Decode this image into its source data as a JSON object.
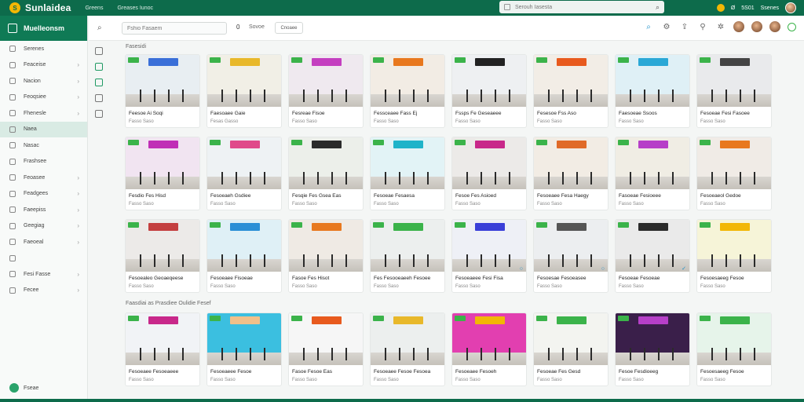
{
  "topbar": {
    "logo_glyph": "S",
    "brand": "Sunlaidea",
    "links": [
      "Greens",
      "Greases Iunoc"
    ],
    "search_placeholder": "Serouh Iasesta",
    "right_items": [
      "Ø",
      "5S01",
      "Ssenes"
    ]
  },
  "sidebar": {
    "header": "Muelleonsm",
    "items": [
      {
        "label": "Serenes",
        "chev": ""
      },
      {
        "label": "Feaceise",
        "chev": "›"
      },
      {
        "label": "Nacion",
        "chev": "›"
      },
      {
        "label": "Feoqsiee",
        "chev": "›"
      },
      {
        "label": "Fhenesle",
        "chev": "›"
      },
      {
        "label": "Naea",
        "chev": "",
        "active": true
      },
      {
        "label": "Nasac",
        "chev": ""
      },
      {
        "label": "Frashsee",
        "chev": ""
      },
      {
        "label": "Feoasee",
        "chev": "›"
      },
      {
        "label": "Feadgees",
        "chev": "›"
      },
      {
        "label": "Faeepiss",
        "chev": "›"
      },
      {
        "label": "Geegiag",
        "chev": "›"
      },
      {
        "label": "Faeoeal",
        "chev": "›"
      },
      {
        "label": "",
        "chev": ""
      },
      {
        "label": "Fesi Fasse",
        "chev": "›"
      },
      {
        "label": "Fecee",
        "chev": "›"
      }
    ],
    "footer": "Fseae"
  },
  "toolbar": {
    "search_placeholder": "Fshio Fasaem",
    "count": "0",
    "label": "Sovoe",
    "button": "Cnoaee"
  },
  "sections": [
    {
      "title": "Fasesidi"
    },
    {
      "title": "Faasdiai as Prasdiee Oulidie Fesef"
    }
  ],
  "colors": {
    "primary": "#0d6b4b",
    "sidebar_header": "#0f7a55",
    "accent_blue": "#1a8fc9",
    "tag_green": "#3bb34a"
  },
  "cards_row1": [
    {
      "t1": "Feesoe Ai Soqi",
      "t2": "Fasso Saso",
      "bg": "#e8eef2",
      "sign": "#3a6fd8"
    },
    {
      "t1": "Faesoaee Gaie",
      "t2": "Fesas Gasso",
      "bg": "#f1efe6",
      "sign": "#e8b82a"
    },
    {
      "t1": "Fesreae Fisoe",
      "t2": "Fasso Saso",
      "bg": "#efe9ef",
      "sign": "#c43fc0"
    },
    {
      "t1": "Fessceaee Fass Ej",
      "t2": "Fasso Saso",
      "bg": "#f2ece4",
      "sign": "#e8781e"
    },
    {
      "t1": "Fssps Fe Geseaeee",
      "t2": "Fasso Saso",
      "bg": "#eef0f2",
      "sign": "#222222"
    },
    {
      "t1": "Fesesoe Fss Aso",
      "t2": "Fasso Saso",
      "bg": "#f2ede6",
      "sign": "#e85a1e"
    },
    {
      "t1": "Faesoeae Ssoos",
      "t2": "Fasso Saso",
      "bg": "#dff0f6",
      "sign": "#2aa8d6"
    },
    {
      "t1": "Fesoeae Fesi Fasoee",
      "t2": "Fasso Saso",
      "bg": "#e9eaec",
      "sign": "#444444"
    }
  ],
  "cards_row2": [
    {
      "t1": "Fesdio Fes Hisd",
      "t2": "Fasso Saso",
      "bg": "#f1e4f1",
      "sign": "#c02fb6"
    },
    {
      "t1": "Fesoeaeh Gsdiee",
      "t2": "Fasso Saso",
      "bg": "#eef2f4",
      "sign": "#e04a8a"
    },
    {
      "t1": "Fesqie Fes Gsea Eas",
      "t2": "Fasso Saso",
      "bg": "#ecefea",
      "sign": "#2b2b2b"
    },
    {
      "t1": "Fesoeae Fesaesa",
      "t2": "Fasso Saso",
      "bg": "#e2f3f6",
      "sign": "#1fb3c9"
    },
    {
      "t1": "Fesoe Fes Asioed",
      "t2": "Fasso Saso",
      "bg": "#eceae8",
      "sign": "#c8288a"
    },
    {
      "t1": "Fesoeaee Fesa Haegy",
      "t2": "Fasso Saso",
      "bg": "#f2ece4",
      "sign": "#e06a28"
    },
    {
      "t1": "Fasoeae Fesioeee",
      "t2": "Fasso Saso",
      "bg": "#f0ede4",
      "sign": "#b63fc8"
    },
    {
      "t1": "Fesoeaeol Gedoe",
      "t2": "Fasso Saso",
      "bg": "#f0ebe6",
      "sign": "#e8781e"
    }
  ],
  "cards_row3": [
    {
      "t1": "Fesoealeo Geoaeqeese",
      "t2": "Fasso Saso",
      "bg": "#eceae8",
      "sign": "#c43f3f"
    },
    {
      "t1": "Fesoeaee Fisoeae",
      "t2": "Fasso Saso",
      "bg": "#dff0f6",
      "sign": "#2a8fd6"
    },
    {
      "t1": "Fasoe Fes Hisot",
      "t2": "Fasso Saso",
      "bg": "#efeae4",
      "sign": "#e8781e"
    },
    {
      "t1": "Fes Fesooeaeeh Fesoee",
      "t2": "Fasso Saso",
      "bg": "#ecefee",
      "sign": "#3bb34a"
    },
    {
      "t1": "Fesoeaeee Fesi Fisa",
      "t2": "Fasso Saso",
      "bg": "#eef0f6",
      "sign": "#3a3fd8",
      "flag": "○"
    },
    {
      "t1": "Fesoesae Fesoeasee",
      "t2": "Fasso Saso",
      "bg": "#eceef0",
      "sign": "#555555",
      "flag": "○"
    },
    {
      "t1": "Fesoeae Fesoeae",
      "t2": "Fasso Saso",
      "bg": "#eaeaea",
      "sign": "#2b2b2b",
      "flag": "✓"
    },
    {
      "t1": "Fesoesaeeg Fesoe",
      "t2": "Fasso Saso",
      "bg": "#f6f4d8",
      "sign": "#f2b705"
    }
  ],
  "cards_row4": [
    {
      "t1": "Fesoeaee Fesoeaeee",
      "t2": "Fasso Saso",
      "bg": "#f1f3f6",
      "sign": "#c8288a"
    },
    {
      "t1": "Fesoeaeee Fesoe",
      "t2": "Fasso Saso",
      "bg": "#3bbfe0",
      "sign": "#f0c08a"
    },
    {
      "t1": "Fasoe Fesoe Eas",
      "t2": "Fasso Saso",
      "bg": "#f6f6f6",
      "sign": "#e85a1e"
    },
    {
      "t1": "Fesoeaee Fesoe Fesoea",
      "t2": "Fasso Saso",
      "bg": "#ecefee",
      "sign": "#e8b82a"
    },
    {
      "t1": "Fesoeaee Fesoeh",
      "t2": "Fasso Saso",
      "bg": "#e23fb0",
      "sign": "#f2b705"
    },
    {
      "t1": "Fesoeae Fes Gesd",
      "t2": "Fasso Saso",
      "bg": "#f3f4f0",
      "sign": "#3bb34a"
    },
    {
      "t1": "Fesoe Fesdioeeg",
      "t2": "Fasso Saso",
      "bg": "#3a1f4a",
      "sign": "#b63fc8"
    },
    {
      "t1": "Fesoesaeeg Fesoe",
      "t2": "Fasso Saso",
      "bg": "#e6f4ea",
      "sign": "#3bb34a"
    }
  ]
}
